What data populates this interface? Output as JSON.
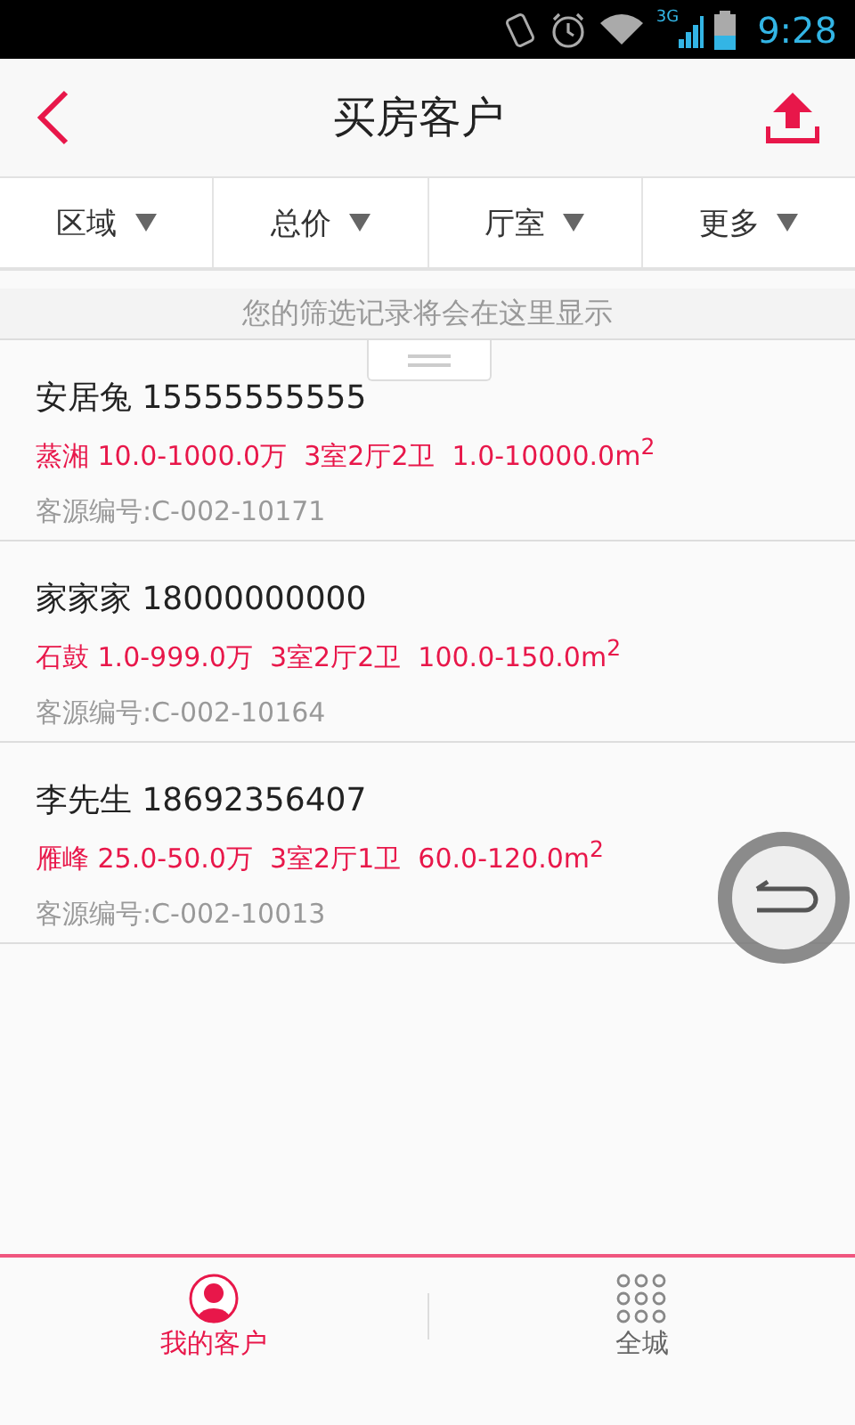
{
  "status_bar": {
    "network": "3G",
    "time": "9:28"
  },
  "header": {
    "title": "买房客户"
  },
  "filters": [
    {
      "label": "区域"
    },
    {
      "label": "总价"
    },
    {
      "label": "厅室"
    },
    {
      "label": "更多"
    }
  ],
  "filter_hint": "您的筛选记录将会在这里显示",
  "customers": [
    {
      "name": "安居兔 15555555555",
      "details": "蒸湘 10.0-1000.0万  3室2厅2卫  1.0-10000.0m$^{2}$",
      "source_id": "客源编号:C-002-10171"
    },
    {
      "name": "家家家 18000000000",
      "details": "石鼓 1.0-999.0万  3室2厅2卫  100.0-150.0m$^{2}$",
      "source_id": "客源编号:C-002-10164"
    },
    {
      "name": "李先生 18692356407",
      "details": "雁峰 25.0-50.0万  3室2厅1卫  60.0-120.0m$^{2}$",
      "source_id": "客源编号:C-002-10013"
    }
  ],
  "bottom_nav": [
    {
      "label": "我的客户",
      "kind": "person",
      "selected": true
    },
    {
      "label": "全城",
      "kind": "grid",
      "selected": false
    }
  ]
}
